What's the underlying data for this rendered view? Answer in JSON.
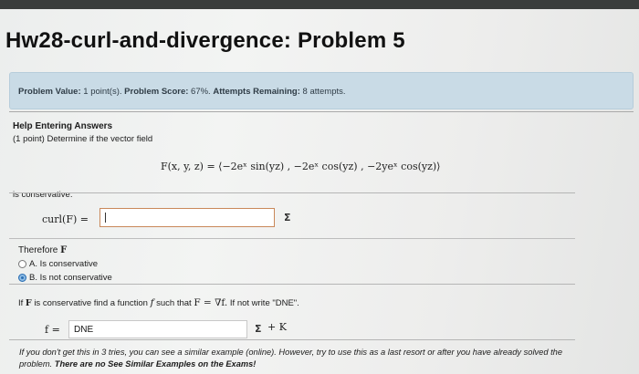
{
  "page_title": "Hw28-curl-and-divergence: Problem 5",
  "info": {
    "value_label": "Problem Value:",
    "value": "1 point(s).",
    "score_label": "Problem Score:",
    "score": "67%.",
    "attempts_label": "Attempts Remaining:",
    "attempts": "8 attempts."
  },
  "help_heading": "Help Entering Answers",
  "prompt": "(1 point) Determine if the vector field",
  "formula": "F(x, y, z) = ⟨−2eˣ sin(yz) , −2eˣ cos(yz) , −2yeˣ cos(yz)⟩",
  "is_conservative_text": "is conservative.",
  "curl": {
    "label": "curl(F) =",
    "value": "",
    "sigma": "Σ"
  },
  "therefore_prefix": "Therefore",
  "therefore_var": "F",
  "options": [
    {
      "label": "A. Is conservative",
      "selected": false
    },
    {
      "label": "B. Is not conservative",
      "selected": true
    }
  ],
  "potential_instructions": {
    "p1": "If",
    "v1": "F",
    "p2": "is conservative find a function",
    "v2": "f",
    "p3": "such that",
    "eq": "F = ∇f.",
    "p4": "If not write \"DNE\"."
  },
  "potential": {
    "label": "f =",
    "value": "DNE",
    "sigma": "Σ",
    "suffix": "+ K"
  },
  "footnote": {
    "text": "If you don't get this in 3 tries, you can see a similar example (online). However, try to use this as a last resort or after you have already solved the problem.",
    "bold": "There are no See Similar Examples on the Exams!"
  },
  "colors": {
    "info_bar": "#c9dbe6",
    "radio_selected": "#2b6fb3",
    "answer_border": "#c9885a"
  }
}
